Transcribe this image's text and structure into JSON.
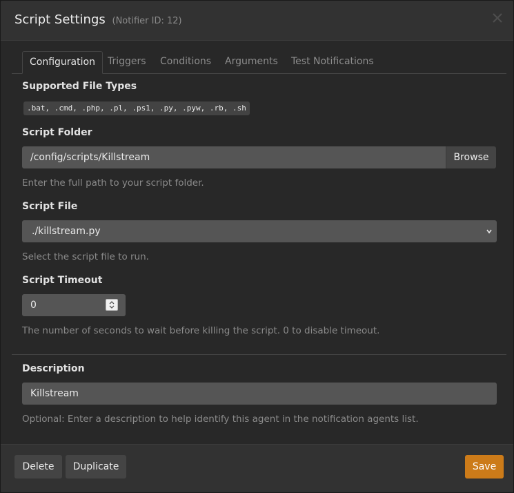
{
  "header": {
    "title": "Script Settings",
    "subtitle": "(Notifier ID: 12)"
  },
  "tabs": [
    {
      "label": "Configuration",
      "active": true
    },
    {
      "label": "Triggers",
      "active": false
    },
    {
      "label": "Conditions",
      "active": false
    },
    {
      "label": "Arguments",
      "active": false
    },
    {
      "label": "Test Notifications",
      "active": false
    }
  ],
  "supported_types": {
    "label": "Supported File Types",
    "value": ".bat, .cmd, .php, .pl, .ps1, .py, .pyw, .rb, .sh"
  },
  "script_folder": {
    "label": "Script Folder",
    "value": "/config/scripts/Killstream",
    "browse_label": "Browse",
    "help": "Enter the full path to your script folder."
  },
  "script_file": {
    "label": "Script File",
    "selected": "./killstream.py",
    "help": "Select the script file to run."
  },
  "script_timeout": {
    "label": "Script Timeout",
    "value": "0",
    "help": "The number of seconds to wait before killing the script. 0 to disable timeout."
  },
  "description": {
    "label": "Description",
    "value": "Killstream",
    "help": "Optional: Enter a description to help identify this agent in the notification agents list."
  },
  "footer": {
    "delete_label": "Delete",
    "duplicate_label": "Duplicate",
    "save_label": "Save"
  },
  "colors": {
    "accent": "#cc7b19",
    "background": "#282828",
    "header": "#323232",
    "input": "#555555"
  },
  "icons": {
    "close": "close-icon",
    "select": "chevron-down-icon",
    "stepper": "stepper-icon"
  }
}
